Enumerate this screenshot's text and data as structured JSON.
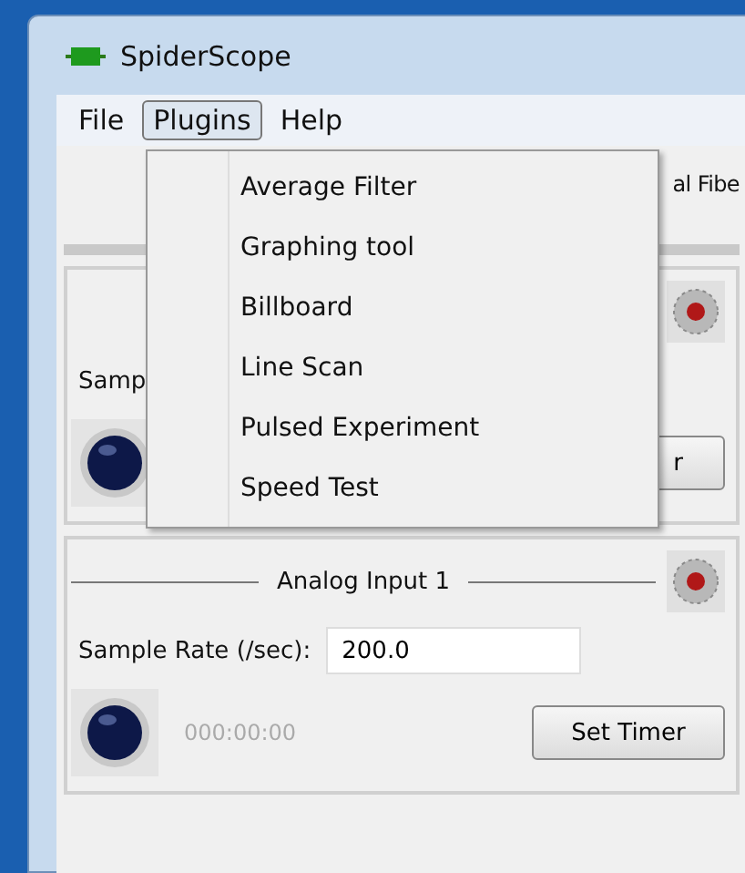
{
  "window": {
    "title": "SpiderScope"
  },
  "menu_bar": [
    {
      "label": "File",
      "selected": false
    },
    {
      "label": "Plugins",
      "selected": true
    },
    {
      "label": "Help",
      "selected": false
    }
  ],
  "plugins_menu": [
    "Average Filter",
    "Graphing tool",
    "Billboard",
    "Line Scan",
    "Pulsed Experiment",
    "Speed Test"
  ],
  "toolbar": {
    "column_1": "al Fibe"
  },
  "panels": [
    {
      "sample_label": "Samp",
      "button": "r"
    },
    {
      "title": "Analog Input 1",
      "sample_label": "Sample Rate (/sec):",
      "sample_value": "200.0",
      "timer": "000:00:00",
      "button": "Set Timer"
    }
  ]
}
